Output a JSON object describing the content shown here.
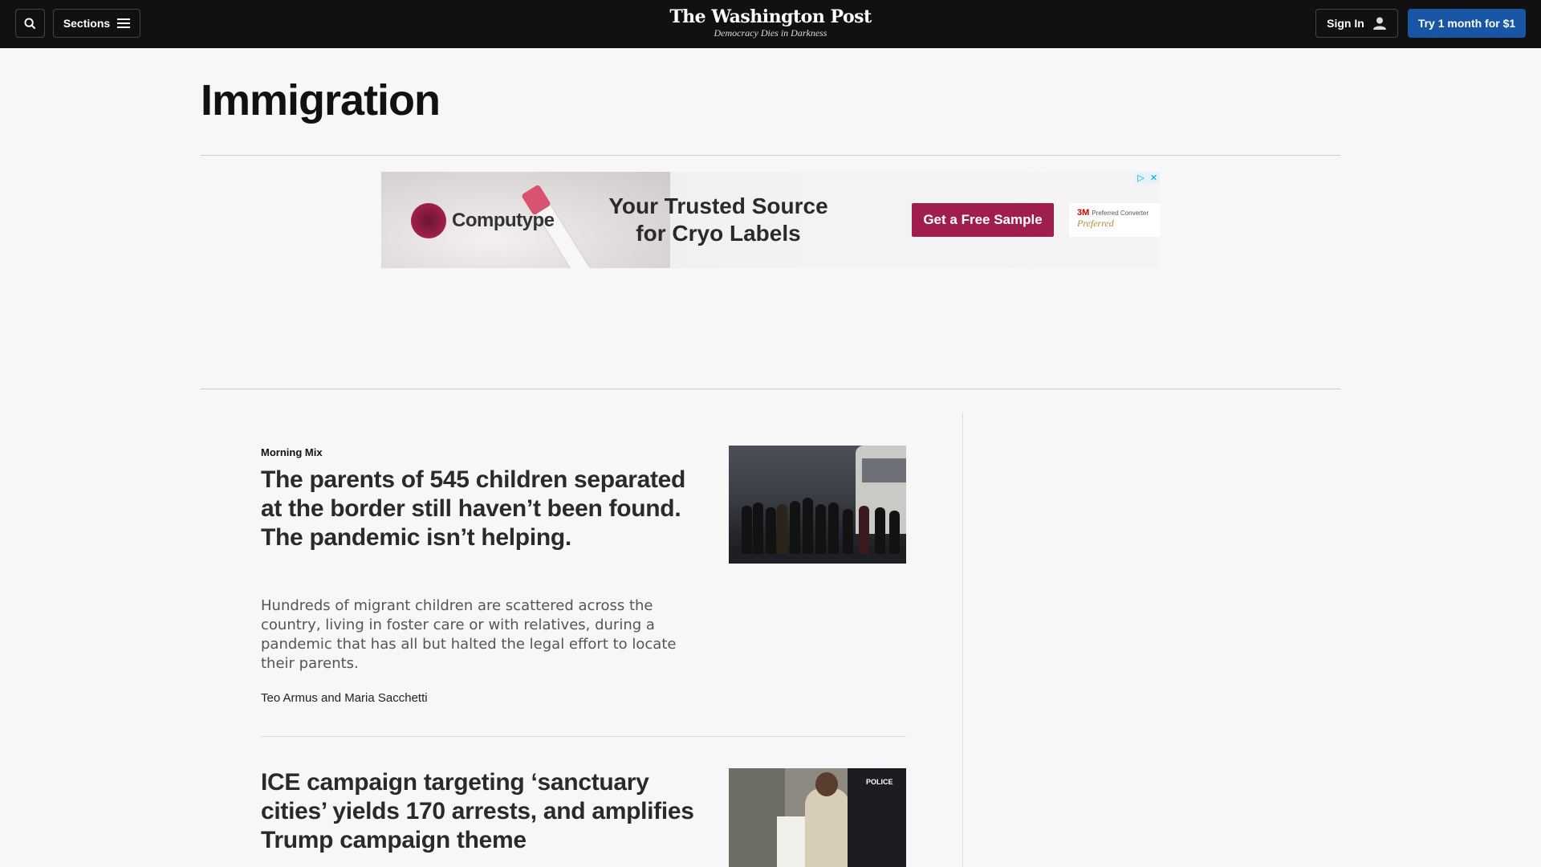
{
  "header": {
    "sections_label": "Sections",
    "logo_name": "The Washington Post",
    "logo_tagline": "Democracy Dies in Darkness",
    "signin_label": "Sign In",
    "subscribe_label": "Try 1 month for $1"
  },
  "page": {
    "title": "Immigration"
  },
  "ad": {
    "brand": "Computype",
    "headline": "Your Trusted Source for Cryo Labels",
    "cta": "Get a Free Sample",
    "partner_logo": "3M",
    "partner_text": "Preferred Converter",
    "partner_sub": "Preferred"
  },
  "stories": [
    {
      "kicker": "Morning Mix",
      "headline": "The parents of 545 children separated at the border still haven’t been found. The pandemic isn’t helping.",
      "blurb": "Hundreds of migrant children are scattered across the country, living in foster care or with relatives, during a pandemic that has all but halted the legal effort to locate their parents.",
      "byline": "Teo Armus and Maria Sacchetti"
    },
    {
      "headline": "ICE campaign targeting ‘sanctuary cities’ yields 170 arrests, and amplifies Trump campaign theme",
      "image_text": "POLICE"
    }
  ]
}
